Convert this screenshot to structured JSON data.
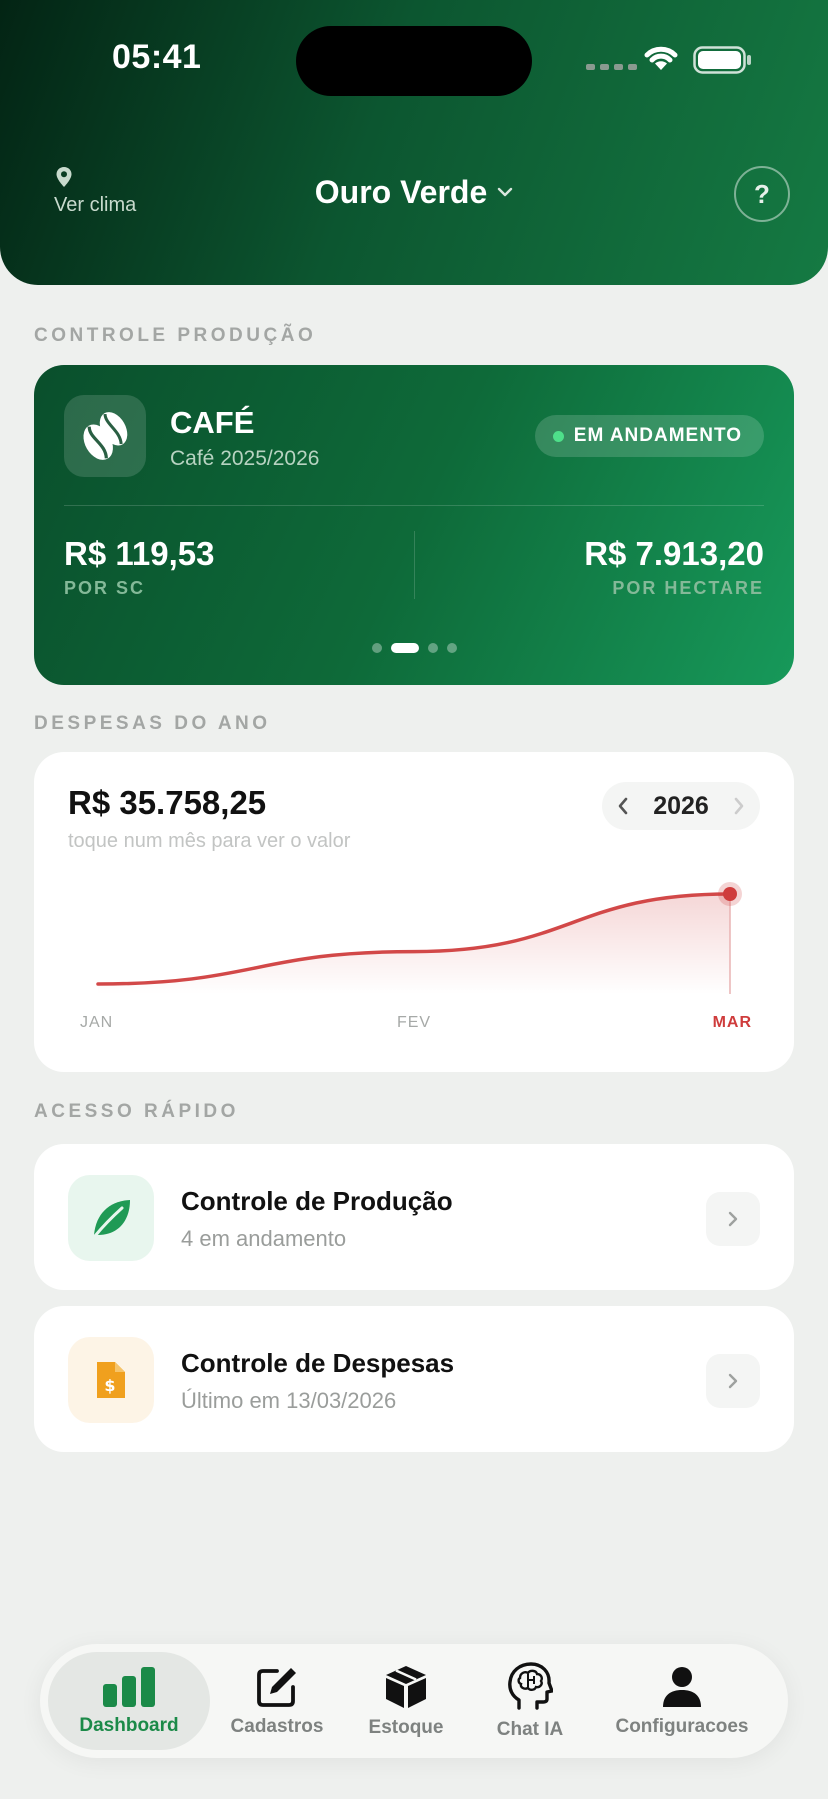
{
  "status_bar": {
    "time": "05:41"
  },
  "header": {
    "weather_label": "Ver clima",
    "farm_name": "Ouro Verde",
    "help_label": "?"
  },
  "production": {
    "section_label": "CONTROLE PRODUÇÃO",
    "crop": "CAFÉ",
    "season": "Café 2025/2026",
    "status": "EM ANDAMENTO",
    "per_sc_value": "R$ 119,53",
    "per_sc_label": "POR SC",
    "per_ha_value": "R$ 7.913,20",
    "per_ha_label": "POR HECTARE",
    "pages": 4,
    "active_page": 1
  },
  "expenses": {
    "section_label": "DESPESAS DO ANO",
    "total": "R$ 35.758,25",
    "hint": "toque num mês para ver o valor",
    "year": "2026",
    "selected_month": "MAR"
  },
  "chart_data": {
    "type": "area",
    "categories": [
      "JAN",
      "FEV",
      "MAR"
    ],
    "series": [
      {
        "values": [
          0.0,
          0.36,
          1.0
        ]
      }
    ],
    "ylim": [
      0,
      1
    ],
    "grid": false,
    "line_color": "#d24848",
    "highlight_color": "#cf3c3c"
  },
  "quick_access": {
    "section_label": "ACESSO RÁPIDO",
    "items": [
      {
        "title": "Controle de Produção",
        "subtitle": "4 em andamento",
        "icon": "leaf-icon",
        "icon_color": "#1f9a55"
      },
      {
        "title": "Controle de Despesas",
        "subtitle": "Último em 13/03/2026",
        "icon": "invoice-icon",
        "icon_color": "#f0a01e"
      }
    ]
  },
  "tabbar": {
    "tabs": [
      {
        "label": "Dashboard",
        "icon": "bar-chart-icon",
        "active": true
      },
      {
        "label": "Cadastros",
        "icon": "edit-icon",
        "active": false
      },
      {
        "label": "Estoque",
        "icon": "box-icon",
        "active": false
      },
      {
        "label": "Chat IA",
        "icon": "brain-icon",
        "active": false
      },
      {
        "label": "Configuracoes",
        "icon": "user-icon",
        "active": false
      }
    ]
  },
  "colors": {
    "brand_green": "#0e6a39",
    "accent_green": "#1b8a48",
    "expense_red": "#d24848"
  }
}
